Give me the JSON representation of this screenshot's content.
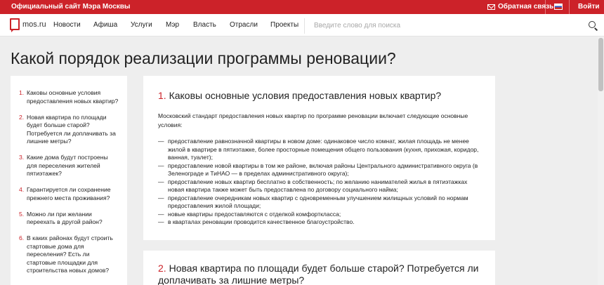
{
  "topbar": {
    "official_site": "Официальный сайт Мэра Москвы",
    "feedback": "Обратная связь",
    "login": "Войти"
  },
  "nav": {
    "logo": "mos.ru",
    "items": [
      "Новости",
      "Афиша",
      "Услуги",
      "Мэр",
      "Власть",
      "Отрасли",
      "Проекты"
    ],
    "search_placeholder": "Введите слово для поиска"
  },
  "page_title": "Какой порядок реализации программы реновации?",
  "toc": [
    {
      "num": "1.",
      "text": "Каковы основные условия предоставления новых квартир?"
    },
    {
      "num": "2.",
      "text": "Новая квартира по площади будет больше старой? Потребуется ли доплачивать за лишние метры?"
    },
    {
      "num": "3.",
      "text": "Какие дома будут построены для переселения жителей пятиэтажек?"
    },
    {
      "num": "4.",
      "text": "Гарантируется ли сохранение прежнего места проживания?"
    },
    {
      "num": "5.",
      "text": "Можно ли при желании переехать в другой район?"
    },
    {
      "num": "6.",
      "text": "В каких районах будут строить стартовые дома для переселения? Есть ли стартовые площадки для строительства новых домов?"
    }
  ],
  "section1": {
    "num": "1.",
    "title": "Каковы основные условия предоставления новых квартир?",
    "intro": "Московский стандарт предоставления новых квартир по программе реновации включает следующие основные условия:",
    "bullets": [
      "предоставление равнозначной квартиры в новом доме: одинаковое число комнат, жилая площадь не менее жилой в квартире в пятиэтажке, более просторные помещения общего пользования (кухня, прихожая, коридор, ванная, туалет);",
      "предоставление новой квартиры в том же районе, включая районы Центрального административного округа (в Зеленограде и ТиНАО — в пределах административного округа);",
      "предоставление новых квартир бесплатно в собственность; по желанию нанимателей жилья в пятиэтажках новая квартира также может быть предоставлена по договору социального найма;",
      "предоставление очередникам новых квартир с одновременным улучшением жилищных условий по нормам предоставления жилой площади;",
      "новые квартиры предоставляются с отделкой комфорткласса;",
      "в кварталах реновации проводится качественное благоустройство."
    ]
  },
  "section2": {
    "num": "2.",
    "title": "Новая квартира по площади будет больше старой? Потребуется ли доплачивать за лишние метры?"
  }
}
